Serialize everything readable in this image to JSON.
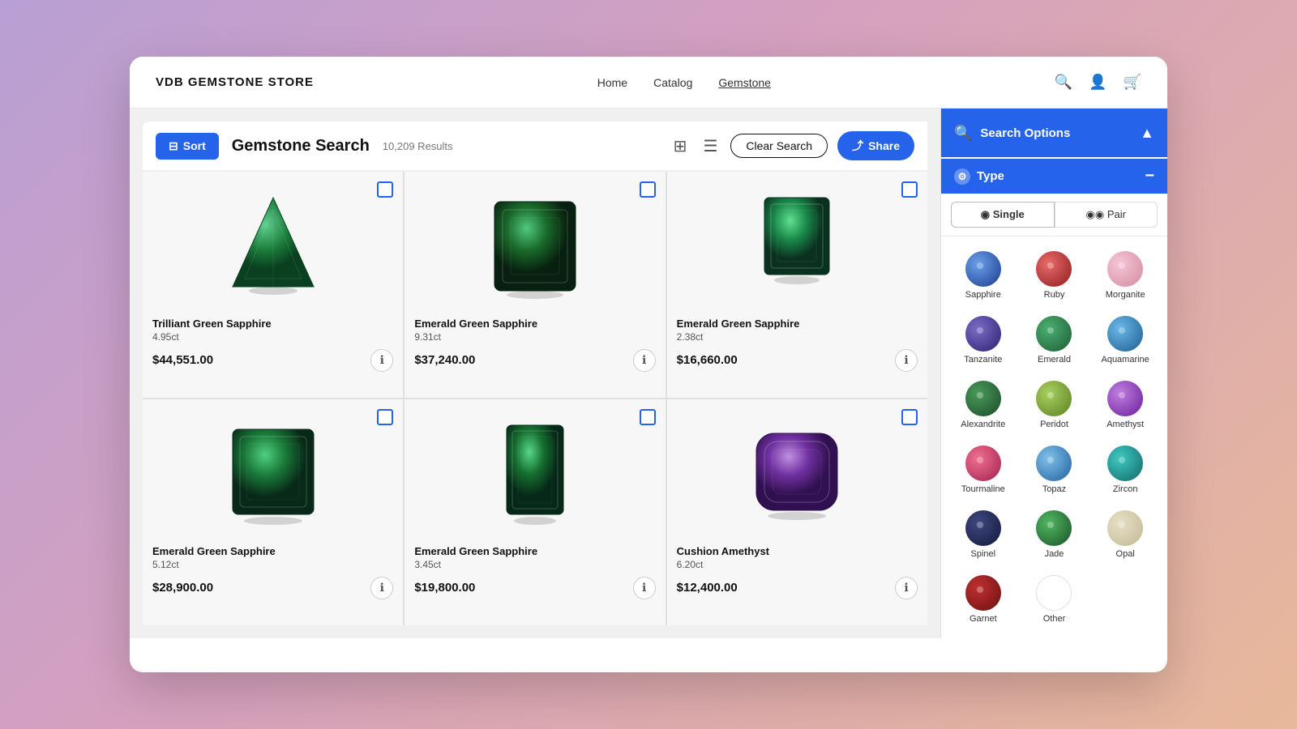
{
  "nav": {
    "brand": "VDB GEMSTONE STORE",
    "links": [
      {
        "label": "Home",
        "active": false
      },
      {
        "label": "Catalog",
        "active": false
      },
      {
        "label": "Gemstone",
        "active": true
      }
    ]
  },
  "toolbar": {
    "sort_label": "Sort",
    "search_title": "Gemstone Search",
    "result_count": "10,209 Results",
    "clear_label": "Clear Search",
    "share_label": "Share"
  },
  "products": [
    {
      "name": "Trilliant Green Sapphire",
      "weight": "4.95ct",
      "price": "$44,551.00",
      "shape": "trilliant",
      "color": "#1a7a3a"
    },
    {
      "name": "Emerald Green Sapphire",
      "weight": "9.31ct",
      "price": "$37,240.00",
      "shape": "emerald",
      "color": "#1a6a2a"
    },
    {
      "name": "Emerald Green Sapphire",
      "weight": "2.38ct",
      "price": "$16,660.00",
      "shape": "emerald",
      "color": "#1a8a4a"
    },
    {
      "name": "Emerald Green Sapphire",
      "weight": "5.12ct",
      "price": "$28,900.00",
      "shape": "emerald",
      "color": "#1a7a3a"
    },
    {
      "name": "Emerald Green Sapphire",
      "weight": "3.45ct",
      "price": "$19,800.00",
      "shape": "emerald-tall",
      "color": "#1a7030"
    },
    {
      "name": "Cushion Amethyst",
      "weight": "6.20ct",
      "price": "$12,400.00",
      "shape": "cushion",
      "color": "#7030a0"
    }
  ],
  "search_options": {
    "label": "Search Options",
    "type_label": "Type",
    "single_label": "Single",
    "pair_label": "Pair"
  },
  "gem_types": [
    {
      "label": "Sapphire",
      "class": "gem-sapphire"
    },
    {
      "label": "Ruby",
      "class": "gem-ruby"
    },
    {
      "label": "Morganite",
      "class": "gem-morganite"
    },
    {
      "label": "Tanzanite",
      "class": "gem-tanzanite"
    },
    {
      "label": "Emerald",
      "class": "gem-emerald"
    },
    {
      "label": "Aquamarine",
      "class": "gem-aquamarine"
    },
    {
      "label": "Alexandrite",
      "class": "gem-alexandrite"
    },
    {
      "label": "Peridot",
      "class": "gem-peridot"
    },
    {
      "label": "Amethyst",
      "class": "gem-amethyst"
    },
    {
      "label": "Tourmaline",
      "class": "gem-tourmaline"
    },
    {
      "label": "Topaz",
      "class": "gem-topaz"
    },
    {
      "label": "Zircon",
      "class": "gem-zircon"
    },
    {
      "label": "Spinel",
      "class": "gem-spinel"
    },
    {
      "label": "Jade",
      "class": "gem-jade"
    },
    {
      "label": "Opal",
      "class": "gem-opal"
    },
    {
      "label": "Garnet",
      "class": "gem-garnet"
    },
    {
      "label": "Other",
      "class": "gem-other"
    }
  ]
}
